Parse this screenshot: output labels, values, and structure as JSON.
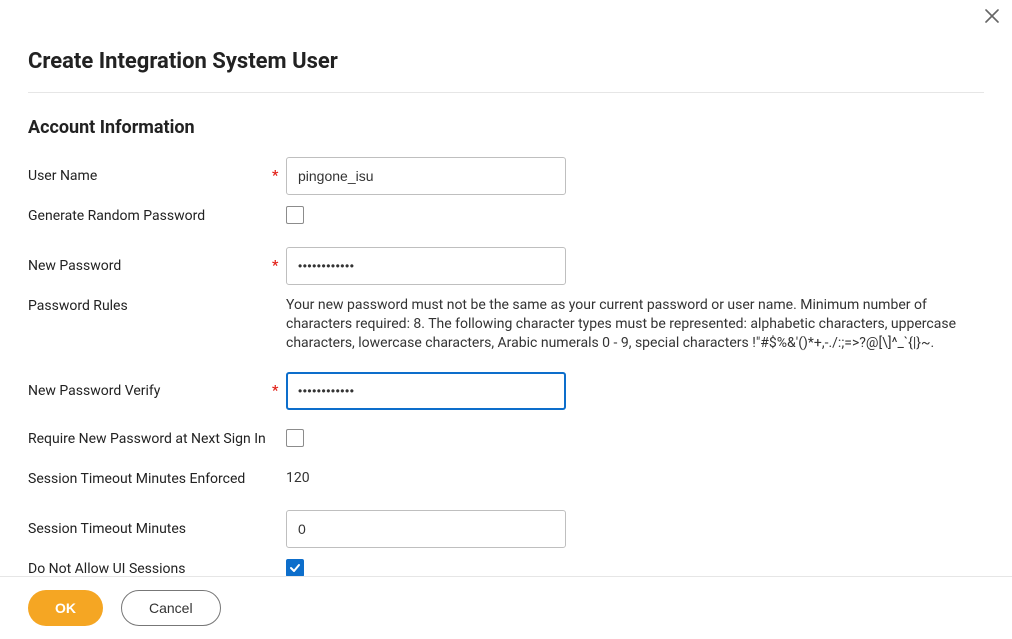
{
  "page_title": "Create Integration System User",
  "section_title": "Account Information",
  "fields": {
    "user_name": {
      "label": "User Name",
      "required": true,
      "value": "pingone_isu"
    },
    "generate_random_password": {
      "label": "Generate Random Password",
      "checked": false
    },
    "new_password": {
      "label": "New Password",
      "required": true,
      "value": "************"
    },
    "password_rules": {
      "label": "Password Rules",
      "text": "Your new password must not be the same as your current password or user name. Minimum number of characters required: 8. The following character types must be represented: alphabetic characters, uppercase characters, lowercase characters, Arabic numerals 0 - 9, special characters !\"#$%&'()*+,-./:;=>?@[\\]^_`{|}~."
    },
    "new_password_verify": {
      "label": "New Password Verify",
      "required": true,
      "value": "************"
    },
    "require_new_password": {
      "label": "Require New Password at Next Sign In",
      "checked": false
    },
    "session_timeout_enforced": {
      "label": "Session Timeout Minutes Enforced",
      "value": "120"
    },
    "session_timeout_minutes": {
      "label": "Session Timeout Minutes",
      "value": "0"
    },
    "do_not_allow_ui_sessions": {
      "label": "Do Not Allow UI Sessions",
      "checked": true
    }
  },
  "buttons": {
    "ok": "OK",
    "cancel": "Cancel"
  }
}
